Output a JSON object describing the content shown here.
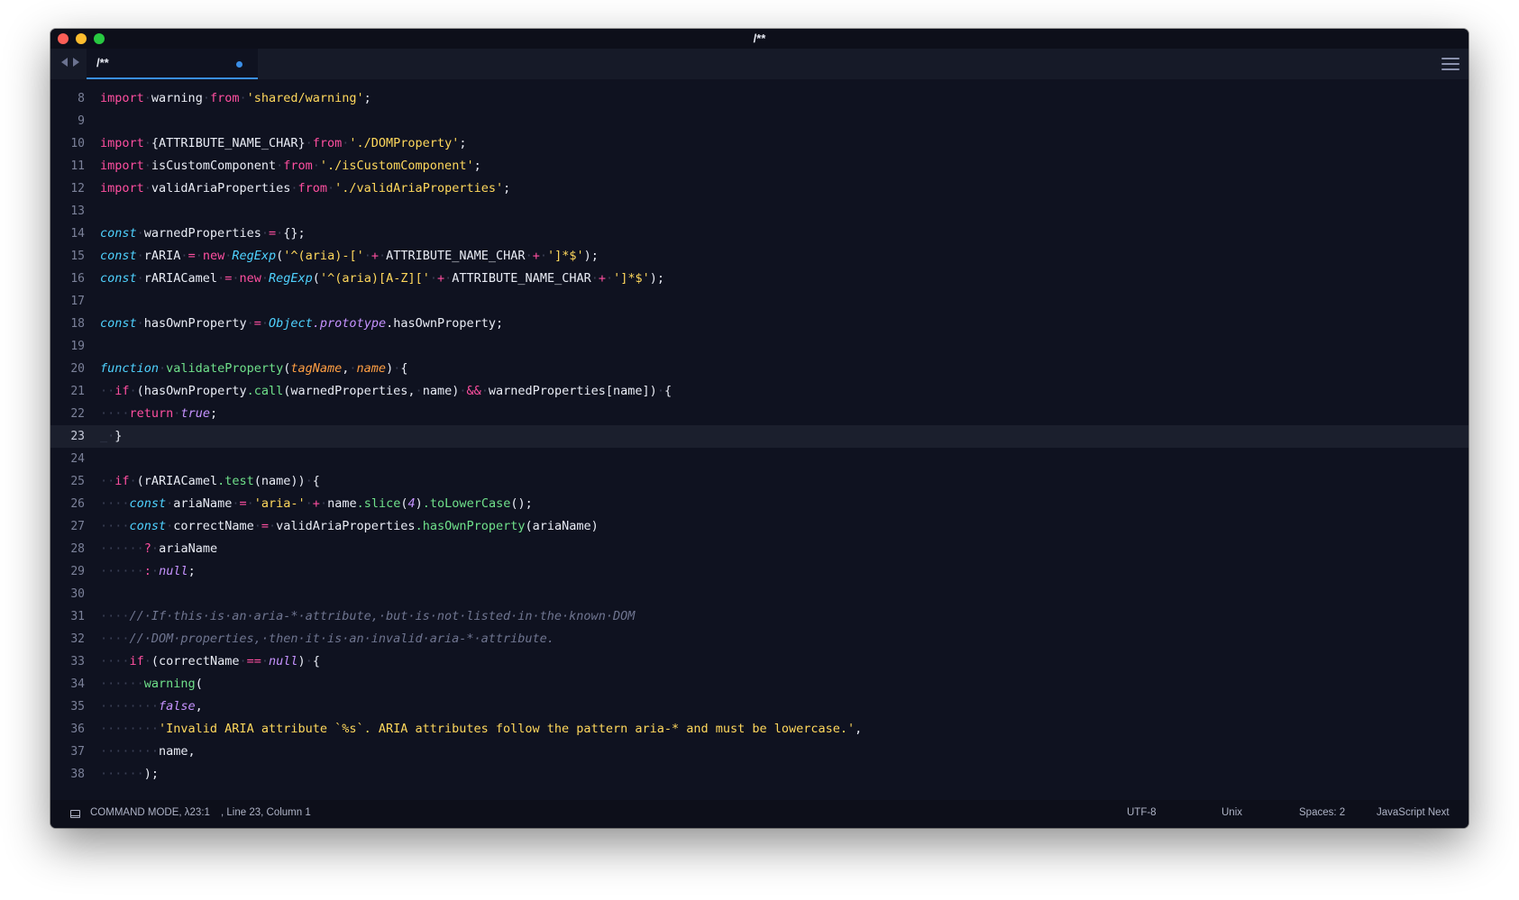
{
  "window": {
    "title": "/**"
  },
  "tab": {
    "label": "/**"
  },
  "editor": {
    "current_line": "23",
    "lines": [
      {
        "n": "8",
        "tokens": [
          [
            "kw",
            "import"
          ],
          [
            "ws",
            "·"
          ],
          [
            "id",
            "warning"
          ],
          [
            "ws",
            "·"
          ],
          [
            "kw",
            "from"
          ],
          [
            "ws",
            "·"
          ],
          [
            "st",
            "'shared/warning'"
          ],
          [
            "id",
            ";"
          ]
        ]
      },
      {
        "n": "9",
        "tokens": []
      },
      {
        "n": "10",
        "tokens": [
          [
            "kw",
            "import"
          ],
          [
            "ws",
            "·"
          ],
          [
            "id",
            "{ATTRIBUTE_NAME_CHAR}"
          ],
          [
            "ws",
            "·"
          ],
          [
            "kw",
            "from"
          ],
          [
            "ws",
            "·"
          ],
          [
            "st",
            "'./DOMProperty'"
          ],
          [
            "id",
            ";"
          ]
        ]
      },
      {
        "n": "11",
        "tokens": [
          [
            "kw",
            "import"
          ],
          [
            "ws",
            "·"
          ],
          [
            "id",
            "isCustomComponent"
          ],
          [
            "ws",
            "·"
          ],
          [
            "kw",
            "from"
          ],
          [
            "ws",
            "·"
          ],
          [
            "st",
            "'./isCustomComponent'"
          ],
          [
            "id",
            ";"
          ]
        ]
      },
      {
        "n": "12",
        "tokens": [
          [
            "kw",
            "import"
          ],
          [
            "ws",
            "·"
          ],
          [
            "id",
            "validAriaProperties"
          ],
          [
            "ws",
            "·"
          ],
          [
            "kw",
            "from"
          ],
          [
            "ws",
            "·"
          ],
          [
            "st",
            "'./validAriaProperties'"
          ],
          [
            "id",
            ";"
          ]
        ]
      },
      {
        "n": "13",
        "tokens": []
      },
      {
        "n": "14",
        "tokens": [
          [
            "sk",
            "const"
          ],
          [
            "ws",
            "·"
          ],
          [
            "id",
            "warnedProperties"
          ],
          [
            "ws",
            "·"
          ],
          [
            "op",
            "="
          ],
          [
            "ws",
            "·"
          ],
          [
            "id",
            "{};"
          ]
        ]
      },
      {
        "n": "15",
        "tokens": [
          [
            "sk",
            "const"
          ],
          [
            "ws",
            "·"
          ],
          [
            "id",
            "rARIA"
          ],
          [
            "ws",
            "·"
          ],
          [
            "op",
            "="
          ],
          [
            "ws",
            "·"
          ],
          [
            "kw",
            "new"
          ],
          [
            "ws",
            "·"
          ],
          [
            "sk",
            "RegExp"
          ],
          [
            "id",
            "("
          ],
          [
            "st",
            "'^(aria)-['"
          ],
          [
            "ws",
            "·"
          ],
          [
            "op",
            "+"
          ],
          [
            "ws",
            "·"
          ],
          [
            "id",
            "ATTRIBUTE_NAME_CHAR"
          ],
          [
            "ws",
            "·"
          ],
          [
            "op",
            "+"
          ],
          [
            "ws",
            "·"
          ],
          [
            "st",
            "']*$'"
          ],
          [
            "id",
            ");"
          ]
        ]
      },
      {
        "n": "16",
        "tokens": [
          [
            "sk",
            "const"
          ],
          [
            "ws",
            "·"
          ],
          [
            "id",
            "rARIACamel"
          ],
          [
            "ws",
            "·"
          ],
          [
            "op",
            "="
          ],
          [
            "ws",
            "·"
          ],
          [
            "kw",
            "new"
          ],
          [
            "ws",
            "·"
          ],
          [
            "sk",
            "RegExp"
          ],
          [
            "id",
            "("
          ],
          [
            "st",
            "'^(aria)[A-Z]['"
          ],
          [
            "ws",
            "·"
          ],
          [
            "op",
            "+"
          ],
          [
            "ws",
            "·"
          ],
          [
            "id",
            "ATTRIBUTE_NAME_CHAR"
          ],
          [
            "ws",
            "·"
          ],
          [
            "op",
            "+"
          ],
          [
            "ws",
            "·"
          ],
          [
            "st",
            "']*$'"
          ],
          [
            "id",
            ");"
          ]
        ]
      },
      {
        "n": "17",
        "tokens": []
      },
      {
        "n": "18",
        "tokens": [
          [
            "sk",
            "const"
          ],
          [
            "ws",
            "·"
          ],
          [
            "id",
            "hasOwnProperty"
          ],
          [
            "ws",
            "·"
          ],
          [
            "op",
            "="
          ],
          [
            "ws",
            "·"
          ],
          [
            "sk",
            "Object"
          ],
          [
            "bl",
            "."
          ],
          [
            "bl",
            "prototype"
          ],
          [
            "id",
            "."
          ],
          [
            "id",
            "hasOwnProperty;"
          ]
        ]
      },
      {
        "n": "19",
        "tokens": []
      },
      {
        "n": "20",
        "tokens": [
          [
            "sk",
            "function"
          ],
          [
            "ws",
            "·"
          ],
          [
            "fn",
            "validateProperty"
          ],
          [
            "id",
            "("
          ],
          [
            "pa",
            "tagName"
          ],
          [
            "id",
            ","
          ],
          [
            "ws",
            "·"
          ],
          [
            "pa",
            "name"
          ],
          [
            "id",
            ")"
          ],
          [
            "ws",
            "·"
          ],
          [
            "id",
            "{"
          ]
        ]
      },
      {
        "n": "21",
        "tokens": [
          [
            "ws",
            "··"
          ],
          [
            "kw",
            "if"
          ],
          [
            "ws",
            "·"
          ],
          [
            "id",
            "(hasOwnProperty"
          ],
          [
            "pr",
            ".call"
          ],
          [
            "id",
            "(warnedProperties,"
          ],
          [
            "ws",
            "·"
          ],
          [
            "id",
            "name)"
          ],
          [
            "ws",
            "·"
          ],
          [
            "op",
            "&&"
          ],
          [
            "ws",
            "·"
          ],
          [
            "id",
            "warnedProperties[name])"
          ],
          [
            "ws",
            "·"
          ],
          [
            "id",
            "{"
          ]
        ]
      },
      {
        "n": "22",
        "tokens": [
          [
            "ws",
            "····"
          ],
          [
            "kw",
            "return"
          ],
          [
            "ws",
            "·"
          ],
          [
            "bl",
            "true"
          ],
          [
            "id",
            ";"
          ]
        ]
      },
      {
        "n": "23",
        "tokens": [
          [
            "ws",
            "_·"
          ],
          [
            "id",
            "}"
          ]
        ]
      },
      {
        "n": "24",
        "tokens": []
      },
      {
        "n": "25",
        "tokens": [
          [
            "ws",
            "··"
          ],
          [
            "kw",
            "if"
          ],
          [
            "ws",
            "·"
          ],
          [
            "id",
            "(rARIACamel"
          ],
          [
            "pr",
            ".test"
          ],
          [
            "id",
            "(name))"
          ],
          [
            "ws",
            "·"
          ],
          [
            "id",
            "{"
          ]
        ]
      },
      {
        "n": "26",
        "tokens": [
          [
            "ws",
            "····"
          ],
          [
            "sk",
            "const"
          ],
          [
            "ws",
            "·"
          ],
          [
            "id",
            "ariaName"
          ],
          [
            "ws",
            "·"
          ],
          [
            "op",
            "="
          ],
          [
            "ws",
            "·"
          ],
          [
            "st",
            "'aria-'"
          ],
          [
            "ws",
            "·"
          ],
          [
            "op",
            "+"
          ],
          [
            "ws",
            "·"
          ],
          [
            "id",
            "name"
          ],
          [
            "pr",
            ".slice"
          ],
          [
            "id",
            "("
          ],
          [
            "bl",
            "4"
          ],
          [
            "id",
            ")"
          ],
          [
            "pr",
            ".toLowerCase"
          ],
          [
            "id",
            "();"
          ]
        ]
      },
      {
        "n": "27",
        "tokens": [
          [
            "ws",
            "····"
          ],
          [
            "sk",
            "const"
          ],
          [
            "ws",
            "·"
          ],
          [
            "id",
            "correctName"
          ],
          [
            "ws",
            "·"
          ],
          [
            "op",
            "="
          ],
          [
            "ws",
            "·"
          ],
          [
            "id",
            "validAriaProperties"
          ],
          [
            "pr",
            ".hasOwnProperty"
          ],
          [
            "id",
            "(ariaName)"
          ]
        ]
      },
      {
        "n": "28",
        "tokens": [
          [
            "ws",
            "······"
          ],
          [
            "op",
            "?"
          ],
          [
            "ws",
            "·"
          ],
          [
            "id",
            "ariaName"
          ]
        ]
      },
      {
        "n": "29",
        "tokens": [
          [
            "ws",
            "······"
          ],
          [
            "op",
            ":"
          ],
          [
            "ws",
            "·"
          ],
          [
            "bl",
            "null"
          ],
          [
            "id",
            ";"
          ]
        ]
      },
      {
        "n": "30",
        "tokens": []
      },
      {
        "n": "31",
        "tokens": [
          [
            "ws",
            "····"
          ],
          [
            "cm",
            "//·If·this·is·an·aria-*·attribute,·but·is·not·listed·in·the·known·DOM"
          ]
        ]
      },
      {
        "n": "32",
        "tokens": [
          [
            "ws",
            "····"
          ],
          [
            "cm",
            "//·DOM·properties,·then·it·is·an·invalid·aria-*·attribute."
          ]
        ]
      },
      {
        "n": "33",
        "tokens": [
          [
            "ws",
            "····"
          ],
          [
            "kw",
            "if"
          ],
          [
            "ws",
            "·"
          ],
          [
            "id",
            "(correctName"
          ],
          [
            "ws",
            "·"
          ],
          [
            "op",
            "=="
          ],
          [
            "ws",
            "·"
          ],
          [
            "bl",
            "null"
          ],
          [
            "id",
            ")"
          ],
          [
            "ws",
            "·"
          ],
          [
            "id",
            "{"
          ]
        ]
      },
      {
        "n": "34",
        "tokens": [
          [
            "ws",
            "······"
          ],
          [
            "fn",
            "warning"
          ],
          [
            "id",
            "("
          ]
        ]
      },
      {
        "n": "35",
        "tokens": [
          [
            "ws",
            "········"
          ],
          [
            "bl",
            "false"
          ],
          [
            "id",
            ","
          ]
        ]
      },
      {
        "n": "36",
        "tokens": [
          [
            "ws",
            "········"
          ],
          [
            "st",
            "'Invalid ARIA attribute `%s`. ARIA attributes follow the pattern aria-* and must be lowercase.'"
          ],
          [
            "id",
            ","
          ]
        ]
      },
      {
        "n": "37",
        "tokens": [
          [
            "ws",
            "········"
          ],
          [
            "id",
            "name,"
          ]
        ]
      },
      {
        "n": "38",
        "tokens": [
          [
            "ws",
            "······"
          ],
          [
            "id",
            ");"
          ]
        ]
      }
    ]
  },
  "status": {
    "mode": "COMMAND MODE, λ23:1",
    "position": ", Line 23, Column 1",
    "encoding": "UTF-8",
    "line_endings": "Unix",
    "indentation": "Spaces: 2",
    "syntax": "JavaScript Next"
  },
  "icons": [
    "back-arrow-icon",
    "forward-arrow-icon",
    "hamburger-menu-icon",
    "console-icon"
  ]
}
